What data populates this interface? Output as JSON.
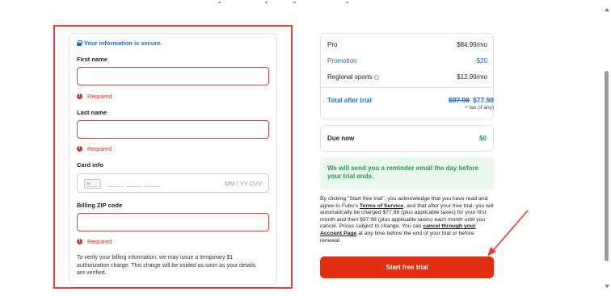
{
  "form": {
    "secure_text": "Your information is secure.",
    "first_name_label": "First name",
    "first_name_value": "",
    "last_name_label": "Last name",
    "last_name_value": "",
    "card_label": "Card info",
    "card_number_placeholder": "____ ____ ____",
    "card_expiry_placeholder": "MM / YY CVV",
    "zip_label": "Billing ZIP code",
    "zip_value": "",
    "required_text": "Required",
    "auth_note": "To verify your billing information, we may issue a temporary $1 authorization charge. This charge will be voided as soon as your details are verified."
  },
  "summary": {
    "rows": [
      {
        "label": "Pro",
        "value": "$84.99/mo"
      },
      {
        "label": "Promotion",
        "value": "-$20"
      },
      {
        "label": "Regional sports",
        "value": "$12.99/mo"
      }
    ],
    "total_label": "Total after trial",
    "total_old": "$97.98",
    "total_new": "$77.98",
    "tax_note": "+ tax (if any)"
  },
  "due": {
    "label": "Due now",
    "value": "$0"
  },
  "reminder": "We will send you a reminder email the day before your trial ends.",
  "legal": {
    "part1": "By clicking \"Start free trial\", you acknowledge that you have read and agree to Fubo's ",
    "terms_link": "Terms of Service",
    "part2": ", and that after your free trial, you will automatically be charged $77.98 (plus applicable taxes) for your first month and then $97.98 (plus applicable taxes) each month until you cancel. Prices subject to change. You can ",
    "account_link": "cancel through your Account Page",
    "part3": " at any time before the end of your trial or before renewal."
  },
  "cta_label": "Start free trial",
  "colors": {
    "accent_blue": "#1a6fd1",
    "error_red": "#d9362f",
    "cta_red": "#e0300f",
    "success_green": "#1f9d4a"
  }
}
